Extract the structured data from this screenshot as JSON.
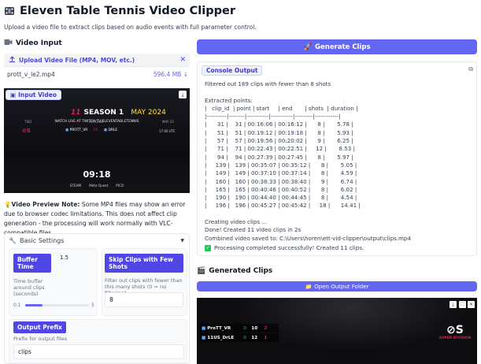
{
  "header": {
    "title": "Eleven Table Tennis Video Clipper",
    "subtitle": "Upload a video file to extract clips based on audio events with full parameter control."
  },
  "video_input": {
    "section_title": "Video Input",
    "upload_label": "Upload Video File (MP4, MOV, etc.)",
    "file_name": "prott_v_le2.mp4",
    "file_size": "596.4 MB ↓",
    "video_label": "Input Video",
    "overlay": {
      "brand": "SEASON 1",
      "month": "MAY 2024",
      "watch_line": "WATCH LIVE AT TWITCH.TV/ELEVENTABLETENNIS",
      "col_left": "TIED",
      "col_mid": "MATCHUP",
      "col_right": "MAY 23",
      "player1": "PROTT_VR",
      "player2": "DRLE",
      "time_utc": "17:00 UTC",
      "clock": "09:18",
      "sponsors": [
        "STEAM",
        "Meta Quest",
        "PICO"
      ]
    }
  },
  "note": {
    "title": "Video Preview Note:",
    "text": " Some MP4 files may show an error due to browser codec limitations. This does not affect clip generation - the processing will work normally with VLC-compatible files."
  },
  "settings": {
    "title": "Basic Settings",
    "buffer_label": "Buffer Time",
    "buffer_value": "1.5",
    "buffer_desc": "Time buffer around clips (seconds)",
    "buffer_min": "0.1",
    "buffer_max": "5",
    "buffer_fraction": 0.28,
    "skip_label": "Skip Clips with Few Shots",
    "skip_desc": "Filter out clips with fewer than this many shots (0 = no filtering)",
    "skip_value": "8",
    "prefix_label": "Output Prefix",
    "prefix_desc": "Prefix for output files",
    "prefix_value": "clips"
  },
  "actions": {
    "generate_label": "Generate Clips"
  },
  "console": {
    "label": "Console Output",
    "lines": [
      "Filtered out 189 clips with fewer than 8 shots",
      "",
      "Extracted points:",
      "|   clip_id  | point | start     | end       | shots  | duration |",
      "|----------|--------|-----------|-----------|---------|------------|",
      "|      31 |    31 | 00:16:06 | 00:16:12 |      8 |       5.78 |",
      "|      51 |    51 | 00:19:12 | 00:19:18 |      8 |       5.93 |",
      "|      57 |    57 | 00:19:56 | 00:20:02 |      9 |       6.25 |",
      "|      71 |    71 | 00:22:43 | 00:22:51 |     12 |       8.53 |",
      "|      94 |    94 | 00:27:39 | 00:27:45 |      8 |       5.97 |",
      "|     139 |   139 | 00:35:07 | 00:35:12 |      8 |       5.05 |",
      "|     149 |   149 | 00:37:10 | 00:37:14 |      8 |       4.59 |",
      "|     160 |   160 | 00:38:33 | 00:38:40 |      9 |       6.74 |",
      "|     165 |   165 | 00:40:46 | 00:40:52 |      8 |       6.02 |",
      "|     190 |   190 | 00:44:40 | 00:44:45 |      8 |       4.54 |",
      "|     196 |   196 | 00:45:27 | 00:45:42 |     18 |      14.41 |",
      "",
      "Creating video clips ...",
      "Done! Created 11 video clips in 2s",
      "Combined video saved to: C:\\Users\\horen\\ett-vid-clipper\\output\\clips.mp4",
      ""
    ],
    "success": "Processing completed successfully! Created 11 clips."
  },
  "generated": {
    "section_title": "Generated Clips",
    "open_folder_label": "Open Output Folder",
    "scoreboard": {
      "p1": "ProTT_VR",
      "p2": "11US_DrLE",
      "p1_games": "0",
      "p2_games": "0",
      "p1_points": "10",
      "p2_points": "12",
      "p1_sets": "2",
      "p2_sets": "1",
      "logo_sub": "SUPER DIVISION"
    }
  },
  "colors": {
    "accent": "#6366f1",
    "accent_dark": "#4f46e5",
    "success": "#22c55e",
    "red": "#e11d48"
  }
}
